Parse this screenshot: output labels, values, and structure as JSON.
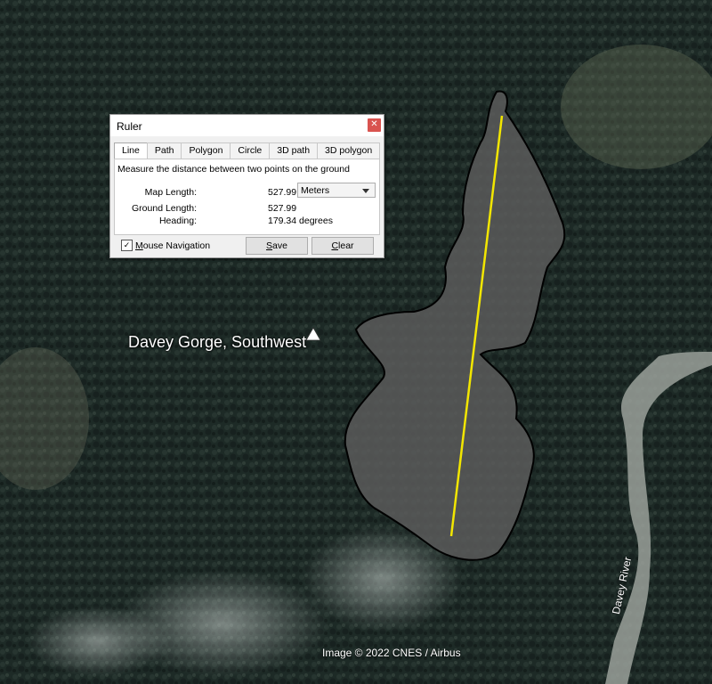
{
  "map": {
    "place_label": "Davey Gorge, Southwest",
    "attribution": "Image © 2022 CNES / Airbus",
    "river_label": "Davey River",
    "measure_line_color": "#f2e600",
    "polygon_fill": "#5a5a5a"
  },
  "ruler": {
    "title": "Ruler",
    "close_icon": "close-icon",
    "tabs": [
      "Line",
      "Path",
      "Polygon",
      "Circle",
      "3D path",
      "3D polygon"
    ],
    "active_tab": "Line",
    "description": "Measure the distance between two points on the ground",
    "map_length_label": "Map Length:",
    "map_length_value": "527.99",
    "units_selected": "Meters",
    "ground_length_label": "Ground Length:",
    "ground_length_value": "527.99",
    "heading_label": "Heading:",
    "heading_value": "179.34 degrees",
    "mouse_navigation_label": "Mouse Navigation",
    "mouse_navigation_checked": true,
    "save_label": "Save",
    "clear_label": "Clear"
  }
}
